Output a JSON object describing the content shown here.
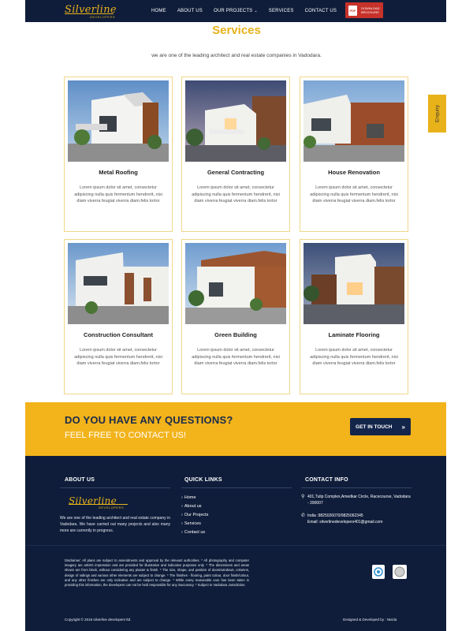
{
  "nav": {
    "logo_text": "Silverline",
    "logo_sub": "DEVELOPERS",
    "items": [
      {
        "label": "HOME"
      },
      {
        "label": "ABOUT US"
      },
      {
        "label": "OUR PROJECTS"
      },
      {
        "label": "SERVICES"
      },
      {
        "label": "CONTACT US"
      }
    ],
    "brochure_line1": "DOWNLOAD",
    "brochure_line2": "BROCHURE",
    "pdf_label": "PDF"
  },
  "services": {
    "title": "Services",
    "subtitle": "we are one of the leading architect and real estate companies in Vadodara.",
    "cards": [
      {
        "title": "Metal Roofing",
        "text": "Lorem ipsum dolor sit amet, consectetur adipiscing nulla quis fermentum hendrerit, nisi diam viverra feugiat viverra diam.felis tortor"
      },
      {
        "title": "General Contracting",
        "text": "Lorem ipsum dolor sit amet, consectetur adipiscing nulla quis fermentum hendrerit, nisi diam viverra feugiat viverra diam.felis tortor"
      },
      {
        "title": "House Renovation",
        "text": "Lorem ipsum dolor sit amet, consectetur adipiscing nulla quis fermentum hendrerit, nisi diam viverra feugiat viverra diam.felis tortor"
      },
      {
        "title": "Construction Consultant",
        "text": "Lorem ipsum dolor sit amet, consectetur adipiscing nulla quis fermentum hendrerit, nisi diam viverra feugiat viverra diam.felis tortor"
      },
      {
        "title": "Green Building",
        "text": "Lorem ipsum dolor sit amet, consectetur adipiscing nulla quis fermentum hendrerit, nisi diam viverra feugiat viverra diam.felis tortor"
      },
      {
        "title": "Laminate Flooring",
        "text": "Lorem ipsum dolor sit amet, consectetur adipiscing nulla quis fermentum hendrerit, nisi diam viverra feugiat viverra diam.felis tortor"
      }
    ]
  },
  "enquiry": {
    "label": "Enquiry"
  },
  "cta": {
    "question": "DO YOU HAVE ANY QUESTIONS?",
    "contact": "FEEL FREE TO CONTACT US!",
    "button": "GET IN TOUCH",
    "button_arrow": "»"
  },
  "footer": {
    "about_title": "ABOUT US",
    "about_text": "We are one of the leading architect and real estate company in Vadodara. We have carried out many projects and also many more are currently in progress.",
    "quick_links_title": "QUICK LINKS",
    "quick_links": [
      {
        "label": "Home"
      },
      {
        "label": "About us"
      },
      {
        "label": "Our Projects"
      },
      {
        "label": "Services"
      },
      {
        "label": "Contact us"
      }
    ],
    "contact_title": "CONTACT INFO",
    "address": "401,Tulip Complex,Amedkar Circle, Racecourse, Vadodara - 390007",
    "phone": "India :9825026070/9825062345",
    "email": "Email: silverlinedevelopers401@gmail.com",
    "disclaimer": "Disclaimer: All plans are subject to amendments and approval by the relevant authorities. * All photography and computer imagery are artist's impression and are provided for illustrative and indicative purposes only. * The dimensions and areas shown are from block, without considering any plaster & finish. * The size, shape, and position of doors/windows, columns, design of railings and various other elements are subject to change. * The finishes - flooring, paint colour, door finish/colour, and any other finishes are only indicative and are subject to change. * While every reasonable care has been taken in providing this information, the developers can not be held responsible for any inaccuracy. * Subject to Vadodara Jurisdiction.",
    "copyright": "Copyright © 2018 silverline developers ltd.",
    "designed_by": "Designed & Developed by : Nivida"
  },
  "colors": {
    "navy": "#0f1d3a",
    "gold": "#e8b21b",
    "cta_yellow": "#f2b31b",
    "brochure_red": "#c6322a"
  }
}
